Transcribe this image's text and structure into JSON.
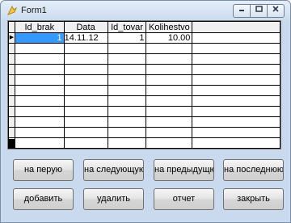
{
  "window": {
    "title": "Form1"
  },
  "grid": {
    "columns": [
      "Id_brak",
      "Data",
      "Id_tovar",
      "Kolihestvo",
      ""
    ],
    "rows": [
      {
        "id_brak": "1",
        "data": "14.11.12",
        "id_tovar": "1",
        "kolihestvo": "10.00",
        "extra": ""
      }
    ],
    "empty_row_count": 10
  },
  "buttons": {
    "first": "на перую",
    "next": "на следующую",
    "prev": "на предыдущюк",
    "last": "на последнюю",
    "add": "добавить",
    "delete": "удалить",
    "report": "отчет",
    "close": "закрыть"
  }
}
